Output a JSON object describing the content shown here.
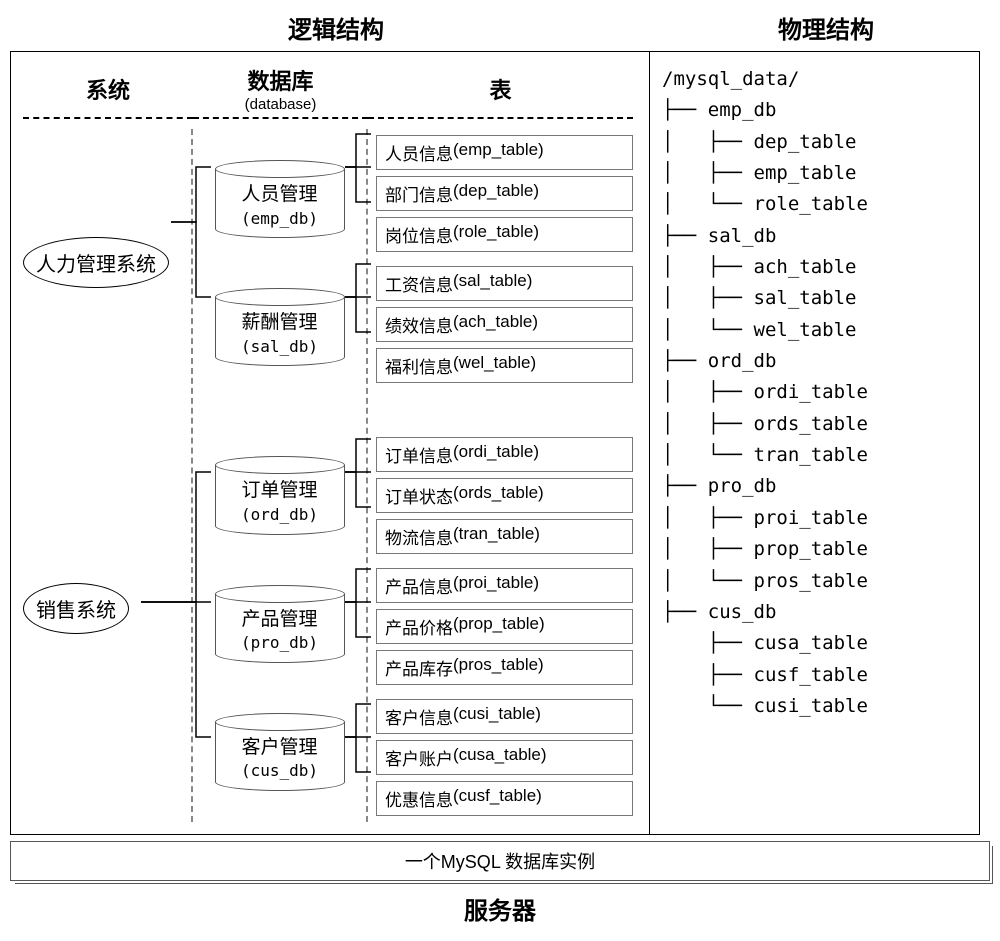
{
  "titles": {
    "logical": "逻辑结构",
    "physical": "物理结构"
  },
  "columns": {
    "system": "系统",
    "database": "数据库",
    "database_sub": "(database)",
    "table": "表"
  },
  "systems": [
    {
      "name": "人力管理系统"
    },
    {
      "name": "销售系统"
    }
  ],
  "databases": [
    {
      "name": "人员管理",
      "code": "(emp_db)"
    },
    {
      "name": "薪酬管理",
      "code": "(sal_db)"
    },
    {
      "name": "订单管理",
      "code": "(ord_db)"
    },
    {
      "name": "产品管理",
      "code": "(pro_db)"
    },
    {
      "name": "客户管理",
      "code": "(cus_db)"
    }
  ],
  "tables": [
    [
      {
        "name": "人员信息",
        "code": "(emp_table)"
      },
      {
        "name": "部门信息",
        "code": "(dep_table)"
      },
      {
        "name": "岗位信息",
        "code": "(role_table)"
      }
    ],
    [
      {
        "name": "工资信息",
        "code": "(sal_table)"
      },
      {
        "name": "绩效信息",
        "code": "(ach_table)"
      },
      {
        "name": "福利信息",
        "code": "(wel_table)"
      }
    ],
    [
      {
        "name": "订单信息",
        "code": "(ordi_table)"
      },
      {
        "name": "订单状态",
        "code": "(ords_table)"
      },
      {
        "name": "物流信息",
        "code": "(tran_table)"
      }
    ],
    [
      {
        "name": "产品信息",
        "code": "(proi_table)"
      },
      {
        "name": "产品价格",
        "code": "(prop_table)"
      },
      {
        "name": "产品库存",
        "code": "(pros_table)"
      }
    ],
    [
      {
        "name": "客户信息",
        "code": "(cusi_table)"
      },
      {
        "name": "客户账户",
        "code": "(cusa_table)"
      },
      {
        "name": "优惠信息",
        "code": "(cusf_table)"
      }
    ]
  ],
  "tree": {
    "root": "/mysql_data/",
    "dbs": [
      {
        "name": "emp_db",
        "tables": [
          "dep_table",
          "emp_table",
          "role_table"
        ]
      },
      {
        "name": "sal_db",
        "tables": [
          "ach_table",
          "sal_table",
          "wel_table"
        ]
      },
      {
        "name": "ord_db",
        "tables": [
          "ordi_table",
          "ords_table",
          "tran_table"
        ]
      },
      {
        "name": "pro_db",
        "tables": [
          "proi_table",
          "prop_table",
          "pros_table"
        ]
      },
      {
        "name": "cus_db",
        "tables": [
          "cusa_table",
          "cusf_table",
          "cusi_table"
        ]
      }
    ]
  },
  "instance_label": "一个MySQL 数据库实例",
  "server_label": "服务器"
}
